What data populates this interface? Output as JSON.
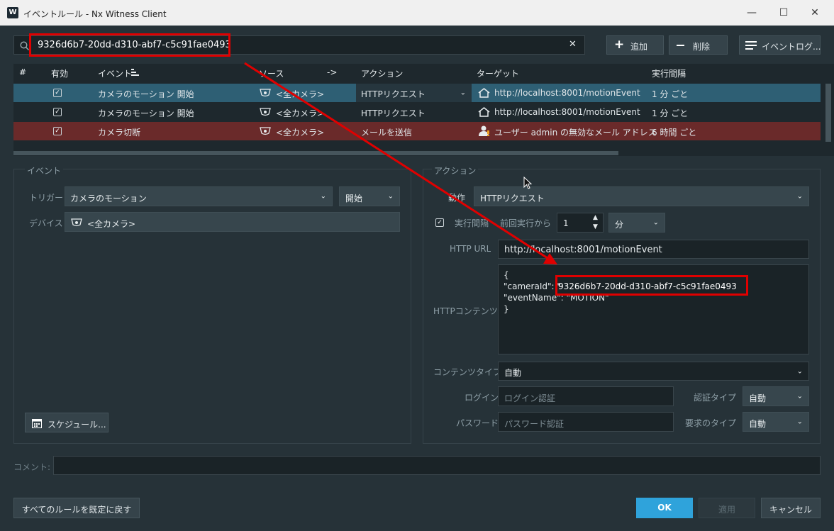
{
  "window": {
    "logo": "W",
    "title": "イベントルール - Nx Witness Client",
    "minimize": "—",
    "maximize": "☐",
    "close": "✕"
  },
  "search": {
    "value": "9326d6b7-20dd-d310-abf7-c5c91fae0493",
    "clear": "✕"
  },
  "toolbar": {
    "add_label": "追加",
    "delete_label": "削除",
    "eventlog_label": "イベントログ..."
  },
  "table": {
    "headers": {
      "num": "#",
      "enabled": "有効",
      "event": "イベント",
      "source": "ソース",
      "arrow": "->",
      "action": "アクション",
      "target": "ターゲット",
      "interval": "実行間隔"
    },
    "rows": [
      {
        "event": "カメラのモーション 開始",
        "source": "<全カメラ>",
        "action": "HTTPリクエスト",
        "target": "http://localhost:8001/motionEvent",
        "interval": "1 分 ごと"
      },
      {
        "event": "カメラのモーション 開始",
        "source": "<全カメラ>",
        "action": "HTTPリクエスト",
        "target": "http://localhost:8001/motionEvent",
        "interval": "1 分 ごと"
      },
      {
        "event": "カメラ切断",
        "source": "<全カメラ>",
        "action": "メールを送信",
        "target": "ユーザー admin の無効なメール アドレス",
        "interval": "6 時間 ごと"
      }
    ]
  },
  "event_panel": {
    "title": "イベント",
    "trigger_label": "トリガー",
    "trigger_value": "カメラのモーション",
    "trigger_state": "開始",
    "device_label": "デバイス",
    "device_value": "<全カメラ>",
    "schedule_button": "スケジュール..."
  },
  "action_panel": {
    "title": "アクション",
    "action_label": "動作",
    "action_value": "HTTPリクエスト",
    "interval_label": "実行間隔",
    "since_label": "前回実行から",
    "interval_value": "1",
    "interval_unit": "分",
    "url_label": "HTTP URL",
    "url_value": "http://localhost:8001/motionEvent",
    "content_label": "HTTPコンテンツ",
    "content_lines": [
      "{",
      "\"cameraId\": \"",
      "\"eventName\": \"MOTION\"",
      "}"
    ],
    "content_camera_id": "9326d6b7-20dd-d310-abf7-c5c91fae0493",
    "content_type_label": "コンテンツタイプ",
    "content_type_value": "自動",
    "login_label": "ログイン",
    "login_placeholder": "ログイン認証",
    "auth_type_label": "認証タイプ",
    "auth_type_value": "自動",
    "password_label": "パスワード",
    "password_placeholder": "パスワード認証",
    "request_type_label": "要求のタイプ",
    "request_type_value": "自動"
  },
  "comment": {
    "label": "コメント:",
    "value": ""
  },
  "footer": {
    "reset_label": "すべてのルールを既定に戻す",
    "ok_label": "OK",
    "apply_label": "適用",
    "cancel_label": "キャンセル"
  },
  "colors": {
    "background": "#263238",
    "selected_row": "#2e5f74",
    "error_row": "#6a2a2a",
    "ok_button": "#2fa3db",
    "annotation": "#e00000"
  }
}
